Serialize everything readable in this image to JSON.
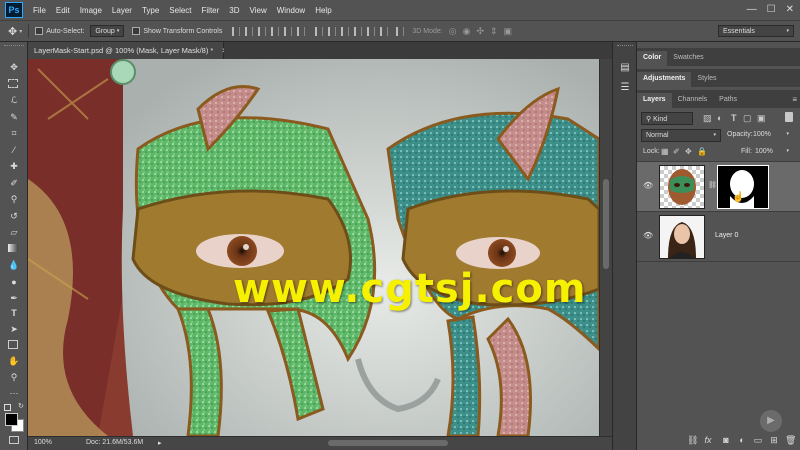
{
  "app": {
    "logo": "Ps"
  },
  "menu": [
    "File",
    "Edit",
    "Image",
    "Layer",
    "Type",
    "Select",
    "Filter",
    "3D",
    "View",
    "Window",
    "Help"
  ],
  "window_controls": {
    "minimize": "—",
    "maximize": "☐",
    "close": "✕"
  },
  "options": {
    "auto_select_label": "Auto-Select:",
    "auto_select_value": "Group",
    "show_transform_label": "Show Transform Controls",
    "mode_3d_label": "3D Mode:",
    "workspace": "Essentials"
  },
  "document": {
    "tab_title": "LayerMask-Start.psd @ 100% (Mask, Layer Mask/8) *",
    "zoom": "100%",
    "doc_size": "Doc: 21.6M/53.6M",
    "watermark": "www.cgtsj.com"
  },
  "panels": {
    "group1_tabs": [
      "Color",
      "Swatches"
    ],
    "group2_tabs": [
      "Adjustments",
      "Styles"
    ],
    "group3_tabs": [
      "Layers",
      "Channels",
      "Paths"
    ],
    "filter_kind": "Kind",
    "blend_mode": "Normal",
    "opacity_label": "Opacity:",
    "opacity_value": "100%",
    "lock_label": "Lock:",
    "fill_label": "Fill:",
    "fill_value": "100%",
    "layers": [
      {
        "name": ""
      },
      {
        "name": "Layer 0"
      }
    ]
  },
  "colors": {
    "ui_dark": "#535353",
    "ps_blue": "#31a8ff",
    "watermark": "#f6f100"
  }
}
